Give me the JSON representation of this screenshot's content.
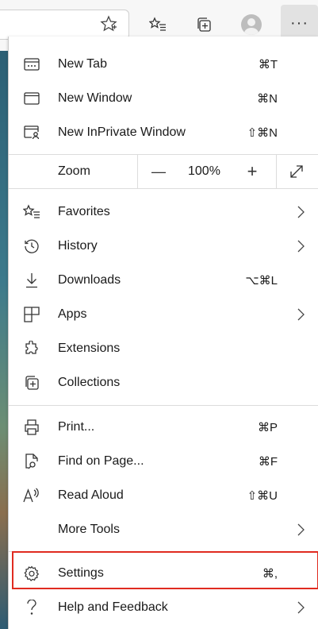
{
  "toolbar": {
    "icons": [
      "favorite-star-icon",
      "favorites-icon",
      "collections-icon",
      "profile-avatar",
      "more-icon"
    ],
    "more_label": "···"
  },
  "menu": {
    "items": [
      {
        "label": "New Tab",
        "shortcut": "⌘T",
        "icon": "new-tab-icon"
      },
      {
        "label": "New Window",
        "shortcut": "⌘N",
        "icon": "new-window-icon"
      },
      {
        "label": "New InPrivate Window",
        "shortcut": "⇧⌘N",
        "icon": "inprivate-icon"
      }
    ],
    "zoom": {
      "label": "Zoom",
      "value": "100%",
      "minus": "—",
      "plus": "+"
    },
    "items2": [
      {
        "label": "Favorites",
        "submenu": true,
        "icon": "favorites-icon"
      },
      {
        "label": "History",
        "submenu": true,
        "icon": "history-icon"
      },
      {
        "label": "Downloads",
        "shortcut": "⌥⌘L",
        "icon": "download-icon"
      },
      {
        "label": "Apps",
        "submenu": true,
        "icon": "apps-icon"
      },
      {
        "label": "Extensions",
        "icon": "extensions-icon"
      },
      {
        "label": "Collections",
        "icon": "collections-icon"
      }
    ],
    "items3": [
      {
        "label": "Print...",
        "shortcut": "⌘P",
        "icon": "print-icon"
      },
      {
        "label": "Find on Page...",
        "shortcut": "⌘F",
        "icon": "find-icon"
      },
      {
        "label": "Read Aloud",
        "shortcut": "⇧⌘U",
        "icon": "read-aloud-icon"
      },
      {
        "label": "More Tools",
        "submenu": true
      }
    ],
    "items4": [
      {
        "label": "Settings",
        "shortcut": "⌘,",
        "icon": "gear-icon"
      },
      {
        "label": "Help and Feedback",
        "submenu": true,
        "icon": "help-icon"
      }
    ],
    "highlight_color": "#e02b20"
  }
}
